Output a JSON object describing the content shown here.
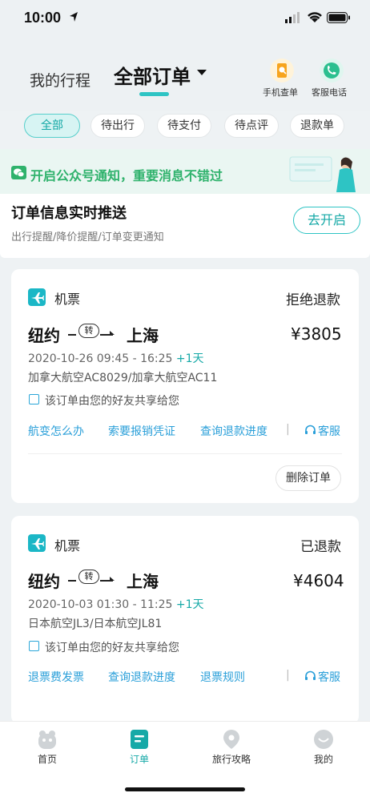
{
  "status_bar": {
    "time": "10:00"
  },
  "header": {
    "tab_trips": "我的行程",
    "tab_all": "全部订单",
    "phone_check_label": "手机查单",
    "service_phone_label": "客服电话"
  },
  "filters": [
    "全部",
    "待出行",
    "待支付",
    "待点评",
    "退款单"
  ],
  "notice": {
    "wechat_title": "开启公众号通知，重要消息不错过",
    "push_title": "订单信息实时推送",
    "push_subtitle": "出行提醒/降价提醒/订单变更通知",
    "open_button": "去开启"
  },
  "orders": [
    {
      "type": "机票",
      "status": "拒绝退款",
      "from": "纽约",
      "transfer": "转",
      "to": "上海",
      "price": "¥3805",
      "times": "2020-10-26 09:45 - 16:25",
      "plus_day": "+1天",
      "flights": "加拿大航空AC8029/加拿大航空AC11",
      "share_note": "该订单由您的好友共享给您",
      "actions": [
        "航变怎么办",
        "索要报销凭证",
        "查询退款进度"
      ],
      "service": "客服",
      "delete_button": "删除订单"
    },
    {
      "type": "机票",
      "status": "已退款",
      "from": "纽约",
      "transfer": "转",
      "to": "上海",
      "price": "¥4604",
      "times": "2020-10-03 01:30 - 11:25",
      "plus_day": "+1天",
      "flights": "日本航空JL3/日本航空JL81",
      "share_note": "该订单由您的好友共享给您",
      "actions": [
        "退票费发票",
        "查询退款进度",
        "退票规则"
      ],
      "service": "客服"
    }
  ],
  "tabbar": {
    "home": "首页",
    "orders": "订单",
    "travel": "旅行攻略",
    "mine": "我的"
  },
  "colors": {
    "accent": "#16a9a7",
    "link": "#2a9fd9",
    "wechat_green": "#2fb26c"
  }
}
